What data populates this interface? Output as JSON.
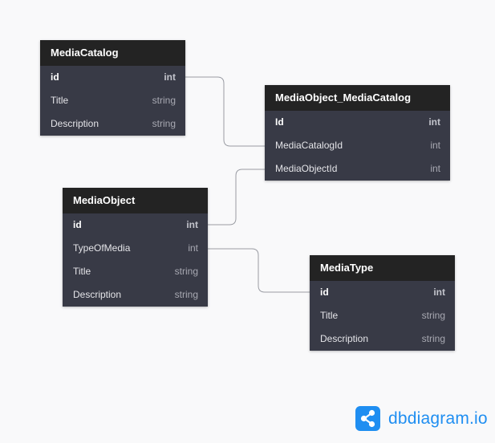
{
  "tables": {
    "media_catalog": {
      "name": "MediaCatalog",
      "fields": [
        {
          "name": "id",
          "type": "int"
        },
        {
          "name": "Title",
          "type": "string"
        },
        {
          "name": "Description",
          "type": "string"
        }
      ]
    },
    "media_object_media_catalog": {
      "name": "MediaObject_MediaCatalog",
      "fields": [
        {
          "name": "Id",
          "type": "int"
        },
        {
          "name": "MediaCatalogId",
          "type": "int"
        },
        {
          "name": "MediaObjectId",
          "type": "int"
        }
      ]
    },
    "media_object": {
      "name": "MediaObject",
      "fields": [
        {
          "name": "id",
          "type": "int"
        },
        {
          "name": "TypeOfMedia",
          "type": "int"
        },
        {
          "name": "Title",
          "type": "string"
        },
        {
          "name": "Description",
          "type": "string"
        }
      ]
    },
    "media_type": {
      "name": "MediaType",
      "fields": [
        {
          "name": "id",
          "type": "int"
        },
        {
          "name": "Title",
          "type": "string"
        },
        {
          "name": "Description",
          "type": "string"
        }
      ]
    }
  },
  "relationships": [
    {
      "from": "MediaCatalog.id",
      "to": "MediaObject_MediaCatalog.MediaCatalogId"
    },
    {
      "from": "MediaObject.id",
      "to": "MediaObject_MediaCatalog.MediaObjectId"
    },
    {
      "from": "MediaObject.TypeOfMedia",
      "to": "MediaType.id"
    }
  ],
  "branding": {
    "text": "dbdiagram.io",
    "icon": "share-nodes-icon",
    "color": "#1f8ef1"
  },
  "colors": {
    "background": "#f9f9fa",
    "header": "#232323",
    "body": "#383a46",
    "connector": "#9a9ca3"
  }
}
